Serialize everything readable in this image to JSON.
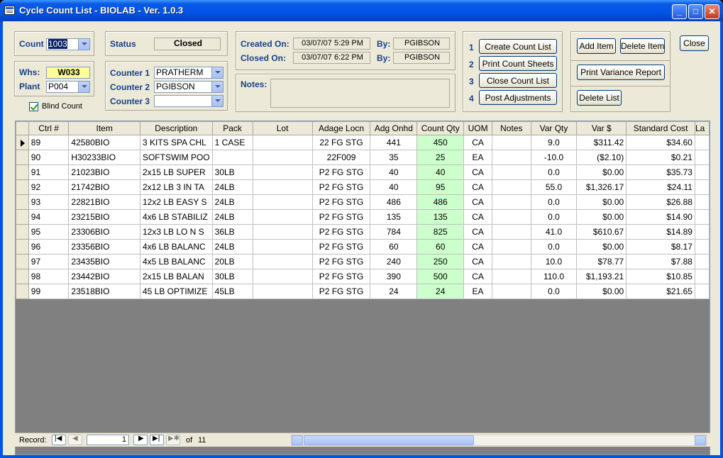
{
  "window": {
    "title": "Cycle Count List -  BIOLAB - Ver. 1.0.3"
  },
  "header": {
    "count_label": "Count",
    "count_value": "1003",
    "whs_label": "Whs:",
    "whs_value": "W033",
    "plant_label": "Plant",
    "plant_value": "P004",
    "blind_count_label": "Blind Count",
    "status_label": "Status",
    "status_value": "Closed",
    "counter1_label": "Counter 1",
    "counter1_value": "PRATHERM",
    "counter2_label": "Counter 2",
    "counter2_value": "PGIBSON",
    "counter3_label": "Counter 3",
    "counter3_value": "",
    "created_on_label": "Created On:",
    "created_on_value": "03/07/07 5:29 PM",
    "closed_on_label": "Closed On:",
    "closed_on_value": "03/07/07 6:22 PM",
    "by_label": "By:",
    "created_by": "PGIBSON",
    "closed_by": "PGIBSON",
    "notes_label": "Notes:",
    "notes_value": ""
  },
  "steps": [
    {
      "num": "1",
      "label": "Create Count List"
    },
    {
      "num": "2",
      "label": "Print Count Sheets"
    },
    {
      "num": "3",
      "label": "Close Count List"
    },
    {
      "num": "4",
      "label": "Post Adjustments"
    }
  ],
  "actions": {
    "add_item": "Add Item",
    "delete_item": "Delete Item",
    "print_variance": "Print Variance Report",
    "delete_list": "Delete List",
    "close": "Close"
  },
  "grid": {
    "columns": [
      "Ctrl #",
      "Item",
      "Description",
      "Pack",
      "Lot",
      "Adage Locn",
      "Adg Onhd",
      "Count Qty",
      "UOM",
      "Notes",
      "Var Qty",
      "Var $",
      "Standard Cost",
      "La"
    ],
    "rows": [
      [
        "89",
        "42580BIO",
        "3 KITS SPA CHL",
        "1 CASE",
        "",
        "22 FG STG",
        "441",
        "450",
        "CA",
        "",
        "9.0",
        "$311.42",
        "$34.60"
      ],
      [
        "90",
        "H30233BIO",
        "SOFTSWIM POO",
        "",
        "",
        "22F009",
        "35",
        "25",
        "EA",
        "",
        "-10.0",
        "($2.10)",
        "$0.21"
      ],
      [
        "91",
        "21023BIO",
        "2x15 LB SUPER",
        "30LB",
        "",
        "P2 FG STG",
        "40",
        "40",
        "CA",
        "",
        "0.0",
        "$0.00",
        "$35.73"
      ],
      [
        "92",
        "21742BIO",
        "2x12 LB 3 IN TA",
        "24LB",
        "",
        "P2 FG STG",
        "40",
        "95",
        "CA",
        "",
        "55.0",
        "$1,326.17",
        "$24.11"
      ],
      [
        "93",
        "22821BIO",
        "12x2 LB EASY S",
        "24LB",
        "",
        "P2 FG STG",
        "486",
        "486",
        "CA",
        "",
        "0.0",
        "$0.00",
        "$26.88"
      ],
      [
        "94",
        "23215BIO",
        "4x6 LB STABILIZ",
        "24LB",
        "",
        "P2 FG STG",
        "135",
        "135",
        "CA",
        "",
        "0.0",
        "$0.00",
        "$14.90"
      ],
      [
        "95",
        "23306BIO",
        "12x3 LB LO N S",
        "36LB",
        "",
        "P2 FG STG",
        "784",
        "825",
        "CA",
        "",
        "41.0",
        "$610.67",
        "$14.89"
      ],
      [
        "96",
        "23356BIO",
        "4x6 LB BALANC",
        "24LB",
        "",
        "P2 FG STG",
        "60",
        "60",
        "CA",
        "",
        "0.0",
        "$0.00",
        "$8.17"
      ],
      [
        "97",
        "23435BIO",
        "4x5 LB BALANC",
        "20LB",
        "",
        "P2 FG STG",
        "240",
        "250",
        "CA",
        "",
        "10.0",
        "$78.77",
        "$7.88"
      ],
      [
        "98",
        "23442BIO",
        "2x15 LB BALAN",
        "30LB",
        "",
        "P2 FG STG",
        "390",
        "500",
        "CA",
        "",
        "110.0",
        "$1,193.21",
        "$10.85"
      ],
      [
        "99",
        "23518BIO",
        "45 LB OPTIMIZE",
        "45LB",
        "",
        "P2 FG STG",
        "24",
        "24",
        "EA",
        "",
        "0.0",
        "$0.00",
        "$21.65"
      ]
    ]
  },
  "navigator": {
    "record_label": "Record:",
    "current": "1",
    "of_label": "of",
    "total": "11"
  }
}
